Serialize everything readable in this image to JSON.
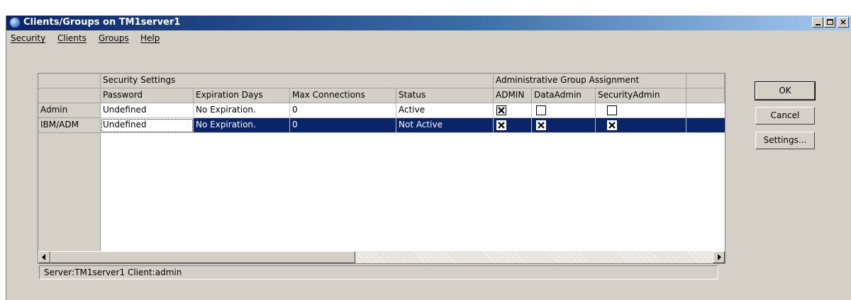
{
  "window": {
    "title": "Clients/Groups on TM1server1"
  },
  "menu": [
    {
      "label": "Security"
    },
    {
      "label": "Clients"
    },
    {
      "label": "Groups"
    },
    {
      "label": "Help"
    }
  ],
  "grid": {
    "group_headers": {
      "security": "Security Settings",
      "admin_groups": "Administrative Group Assignment"
    },
    "columns": [
      "Password",
      "Expiration Days",
      "Max Connections",
      "Status",
      "ADMIN",
      "DataAdmin",
      "SecurityAdmin"
    ],
    "rows": [
      {
        "client": "Admin",
        "password": "Undefined",
        "expiration": "No Expiration.",
        "max_connections": "0",
        "status": "Active",
        "admin": true,
        "data_admin": false,
        "security_admin": false,
        "selected": false
      },
      {
        "client": "IBM/ADM",
        "password": "Undefined",
        "expiration": "No Expiration.",
        "max_connections": "0",
        "status": "Not Active",
        "admin": true,
        "data_admin": true,
        "security_admin": true,
        "selected": true
      }
    ]
  },
  "buttons": {
    "ok": "OK",
    "cancel": "Cancel",
    "settings": "Settings..."
  },
  "status_bar": "Server:TM1server1  Client:admin",
  "colors": {
    "selection": "#0a246a",
    "dialog_face": "#d4d0c8",
    "title_start": "#0a246a",
    "title_end": "#a6caf0"
  }
}
